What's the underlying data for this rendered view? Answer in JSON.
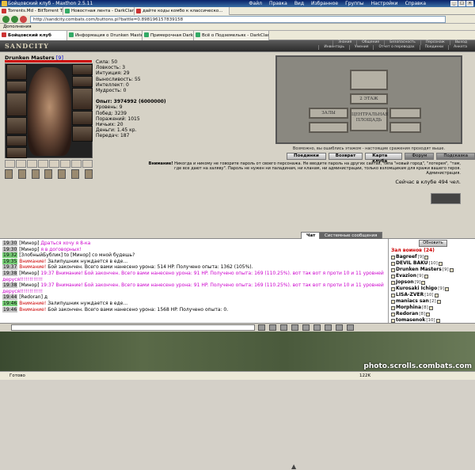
{
  "window": {
    "title": "Бойцовский клуб - Maxthon 2.5.11",
    "menu": [
      "Файл",
      "Правка",
      "Вид",
      "Избранное",
      "Группы",
      "Настройки",
      "Справка"
    ]
  },
  "browser_tabs": [
    "Torrents.Md - BitTorrent Track...",
    "Новостная лента - DarkClan",
    "дайте коды комбо к классическо...",
    "Бойцовский клуб",
    "Информация о Drunken Masters",
    "Примерочная DarkClan",
    "Всё о Подземельях - DarkClan.Ru"
  ],
  "address": "http://sandcity.combats.com/buttons.pl?battle=0.898196157839158",
  "bookmarks": [
    "Дополнения"
  ],
  "game": {
    "logo": "SANDCITY",
    "menu_top": [
      "Знания",
      "Общение",
      "Безопасность",
      "Персонаж",
      "Выход"
    ],
    "menu_bottom": [
      "Инвентарь",
      "Умения",
      "Отчет о переводах",
      "Поединки",
      "Анкета"
    ],
    "char_name": "Drunken Masters",
    "char_level": "[9]",
    "stats": [
      "Сила: 50",
      "Ловкость: 3",
      "Интуиция: 29",
      "Выносливость: 55",
      "Интеллект: 0",
      "Мудрость: 0"
    ],
    "stats2": [
      "Опыт: 3974992 (6000000)",
      "Уровень: 9",
      "Побед: 3239",
      "Поражений: 1015",
      "Ничьих: 20",
      "Деньги: 1.45 кр.",
      "Передач: 187"
    ],
    "map_label": "Возможно, вы ошиблись этажом - настоящие сражения проходят выше.",
    "rooms": {
      "floor": "2 ЭТАЖ",
      "hall": "ЗАЛЫ",
      "central": "ЦЕНТРАЛЬНАЯ ПЛОЩАДЬ"
    },
    "buttons": [
      "Поединки",
      "Возврат",
      "Карта клуба",
      "Форум",
      "Подсказка"
    ],
    "warning_bold": "Внимание!",
    "warning": "Никогда и никому не говорите пароль от своего персонажа. Не вводите пароль на других сайтах, типа \"новый город\", \"лотерея\", \"там, где все дают на халяву\". Пароль не нужен ни паладинам, ни кланам, ни администрации, только взломщикам для кражи вашего героя.",
    "warning_sig": "Администрация.",
    "online": "Сейчас в клубе 494 чел."
  },
  "chat": {
    "tabs": [
      "Чат",
      "Системные сообщения"
    ],
    "lines": [
      {
        "t": "19:30",
        "nick": "[Минор]",
        "text": "Драться хочу я 8-ка",
        "cls": "pink"
      },
      {
        "t": "19:30",
        "nick": "[Минор]",
        "text": "я в договорных!",
        "cls": "pink"
      },
      {
        "t": "19:32",
        "g": true,
        "nick": "[ЗлобныйБублик]",
        "text": "to [Минор] со мной будешь?",
        "cls": ""
      },
      {
        "t": "19:35",
        "g": true,
        "nick": "",
        "sys": "Внимание!",
        "text": "Залипушник нуждается в еде...",
        "cls": ""
      },
      {
        "t": "19:37",
        "nick": "",
        "sys": "Внимание!",
        "text": "Бой закончен. Всего вами нанесено урона: 514 HP. Получено опыта: 1362 (105%).",
        "cls": ""
      },
      {
        "t": "19:38",
        "nick": "[Минор]",
        "text": "19:37 Внимание! Бой закончен. Всего вами нанесено урона: 91 HP. Получено опыта: 169 (110.25%). вот так вот я проти 10 и 11 уровней деруся!!!!!!!!!!!!",
        "cls": "pink"
      },
      {
        "t": "19:38",
        "nick": "[Минор]",
        "text": "19:37 Внимание! Бой закончен. Всего вами нанесено урона: 91 HP. Получено опыта: 169 (110.25%). вот так вот я проти 10 и 11 уровней деруся!!!!!!!!!!!!",
        "cls": "pink"
      },
      {
        "t": "19:44",
        "nick": "[Redoran]",
        "text": "д",
        "cls": ""
      },
      {
        "t": "19:46",
        "g": true,
        "nick": "",
        "sys": "Внимание!",
        "text": "Залипушник нуждается в еде...",
        "cls": ""
      },
      {
        "t": "19:46",
        "nick": "",
        "sys": "Внимание!",
        "text": "Бой закончен. Всего вами нанесено урона: 1568 HP. Получено опыта: 0.",
        "cls": ""
      }
    ]
  },
  "players": {
    "refresh": "Обновить",
    "header": "Зал воинов (24)",
    "list": [
      {
        "name": "Bagreef",
        "lv": "[9]"
      },
      {
        "name": "DEVIL BAKU",
        "lv": "[10]"
      },
      {
        "name": "Drunken Masters",
        "lv": "[9]"
      },
      {
        "name": "Evazion",
        "lv": "[9]"
      },
      {
        "name": "Jopson",
        "lv": "[9]"
      },
      {
        "name": "Kurosaki Ichigo",
        "lv": "[9]"
      },
      {
        "name": "LISA-ZVER",
        "lv": "[10]"
      },
      {
        "name": "maniacs san",
        "lv": "[2]"
      },
      {
        "name": "Morphina",
        "lv": "[8]"
      },
      {
        "name": "Redoran",
        "lv": "[8]"
      },
      {
        "name": "tomasenok",
        "lv": "[10]"
      },
      {
        "name": "Vilich",
        "lv": "[10]"
      },
      {
        "name": "Бормалей",
        "lv": "[6]"
      }
    ]
  },
  "status": {
    "text": "Готово",
    "zoom": "122K",
    "watermark": "photo.scrolls.combats.com"
  }
}
